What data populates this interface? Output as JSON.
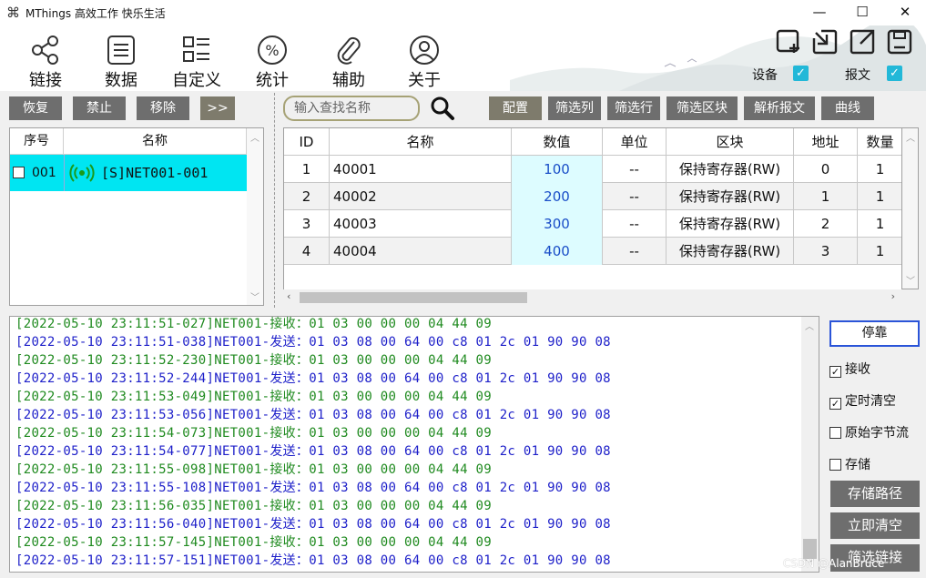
{
  "window": {
    "title": "MThings 高效工作 快乐生活",
    "icon": "command-icon",
    "controls": {
      "minimize": "—",
      "maximize": "☐",
      "close": "✕"
    }
  },
  "nav": {
    "items": [
      {
        "label": "链接",
        "icon": "share-icon"
      },
      {
        "label": "数据",
        "icon": "list-doc-icon",
        "active": true
      },
      {
        "label": "自定义",
        "icon": "custom-grid-icon"
      },
      {
        "label": "统计",
        "icon": "percent-icon"
      },
      {
        "label": "辅助",
        "icon": "paperclip-icon"
      },
      {
        "label": "关于",
        "icon": "user-icon"
      }
    ],
    "tools": [
      "add-window-icon",
      "minimize-window-icon",
      "popout-icon",
      "save-icon"
    ],
    "device_label": "设备",
    "device_checked": true,
    "message_label": "报文",
    "message_checked": true,
    "accent": "#e0609a",
    "check_color": "#22b8d8"
  },
  "left": {
    "buttons": [
      "恢复",
      "禁止",
      "移除",
      ">>"
    ],
    "headers": [
      "序号",
      "名称"
    ],
    "rows": [
      {
        "index": "001",
        "name": "[S]NET001-001",
        "checked": false
      }
    ],
    "row_color": "#00e5f2"
  },
  "right": {
    "search_placeholder": "输入查找名称",
    "toolbar": [
      "配置",
      "筛选列",
      "筛选行",
      "筛选区块",
      "解析报文",
      "曲线"
    ],
    "headers": [
      "ID",
      "名称",
      "数值",
      "单位",
      "区块",
      "地址",
      "数量"
    ],
    "rows": [
      {
        "id": "1",
        "name": "40001",
        "value": "100",
        "unit": "--",
        "block": "保持寄存器(RW)",
        "address": "0",
        "count": "1"
      },
      {
        "id": "2",
        "name": "40002",
        "value": "200",
        "unit": "--",
        "block": "保持寄存器(RW)",
        "address": "1",
        "count": "1"
      },
      {
        "id": "3",
        "name": "40003",
        "value": "300",
        "unit": "--",
        "block": "保持寄存器(RW)",
        "address": "2",
        "count": "1"
      },
      {
        "id": "4",
        "name": "40004",
        "value": "400",
        "unit": "--",
        "block": "保持寄存器(RW)",
        "address": "3",
        "count": "1"
      }
    ]
  },
  "log": {
    "lines": [
      {
        "type": "recv",
        "text": "[2022-05-10 23:11:51-027]NET001-接收：01 03 00 00 00 04 44 09"
      },
      {
        "type": "send",
        "text": "[2022-05-10 23:11:51-038]NET001-发送：01 03 08 00 64 00 c8 01 2c 01 90 90 08"
      },
      {
        "type": "recv",
        "text": "[2022-05-10 23:11:52-230]NET001-接收：01 03 00 00 00 04 44 09"
      },
      {
        "type": "send",
        "text": "[2022-05-10 23:11:52-244]NET001-发送：01 03 08 00 64 00 c8 01 2c 01 90 90 08"
      },
      {
        "type": "recv",
        "text": "[2022-05-10 23:11:53-049]NET001-接收：01 03 00 00 00 04 44 09"
      },
      {
        "type": "send",
        "text": "[2022-05-10 23:11:53-056]NET001-发送：01 03 08 00 64 00 c8 01 2c 01 90 90 08"
      },
      {
        "type": "recv",
        "text": "[2022-05-10 23:11:54-073]NET001-接收：01 03 00 00 00 04 44 09"
      },
      {
        "type": "send",
        "text": "[2022-05-10 23:11:54-077]NET001-发送：01 03 08 00 64 00 c8 01 2c 01 90 90 08"
      },
      {
        "type": "recv",
        "text": "[2022-05-10 23:11:55-098]NET001-接收：01 03 00 00 00 04 44 09"
      },
      {
        "type": "send",
        "text": "[2022-05-10 23:11:55-108]NET001-发送：01 03 08 00 64 00 c8 01 2c 01 90 90 08"
      },
      {
        "type": "recv",
        "text": "[2022-05-10 23:11:56-035]NET001-接收：01 03 00 00 00 04 44 09"
      },
      {
        "type": "send",
        "text": "[2022-05-10 23:11:56-040]NET001-发送：01 03 08 00 64 00 c8 01 2c 01 90 90 08"
      },
      {
        "type": "recv",
        "text": "[2022-05-10 23:11:57-145]NET001-接收：01 03 00 00 00 04 44 09"
      },
      {
        "type": "send",
        "text": "[2022-05-10 23:11:57-151]NET001-发送：01 03 08 00 64 00 c8 01 2c 01 90 90 08"
      }
    ],
    "recv_color": "#1f8a1f",
    "send_color": "#1d1fc9"
  },
  "side": {
    "stop_label": "停靠",
    "options": [
      {
        "label": "接收",
        "checked": true
      },
      {
        "label": "定时清空",
        "checked": true
      },
      {
        "label": "原始字节流",
        "checked": false
      },
      {
        "label": "存储",
        "checked": false
      }
    ],
    "buttons": [
      "存储路径",
      "立即清空",
      "筛选链接"
    ]
  },
  "watermark": "CSDN @AlanBruce"
}
